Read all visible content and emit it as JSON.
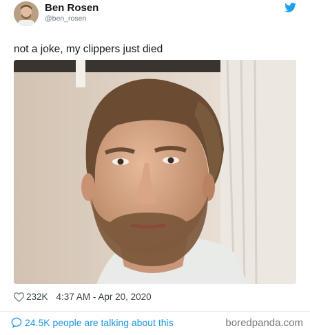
{
  "tweet": {
    "author_name": "Ben Rosen",
    "author_handle": "@ben_rosen",
    "text": "not a joke, my clippers just died",
    "likes": "232K",
    "timestamp": "4:37 AM - Apr 20, 2020",
    "talking": "24.5K people are talking about this"
  },
  "watermark": "boredpanda.com",
  "icons": {
    "brand": "twitter-bird-icon",
    "like": "heart-icon",
    "reply": "speech-bubble-icon"
  },
  "colors": {
    "twitter_blue": "#1da1f2",
    "link_blue": "#1b95e0"
  }
}
